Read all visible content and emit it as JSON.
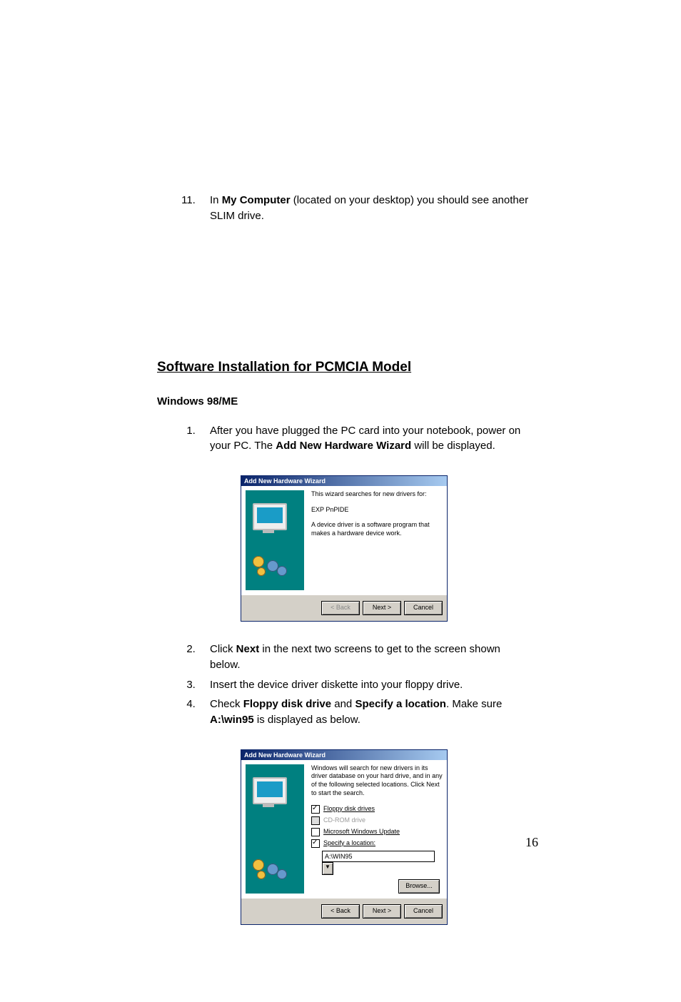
{
  "step11": {
    "num": "11.",
    "pre": "In ",
    "bold": "My Computer",
    "post": " (located on your desktop) you should see another SLIM drive."
  },
  "heading": "Software Installation for PCMCIA Model",
  "subheading": "Windows 98/ME",
  "steps": {
    "s1": {
      "num": "1.",
      "pre": "After you have plugged the PC card into your notebook, power on your PC.  The ",
      "bold": "Add New Hardware Wizard",
      "post": " will be displayed."
    },
    "s2": {
      "num": "2.",
      "pre": "Click ",
      "bold": "Next",
      "post": " in the next two screens to get to the screen shown below."
    },
    "s3": {
      "num": "3.",
      "text": "Insert the device driver diskette into your floppy drive."
    },
    "s4": {
      "num": "4.",
      "pre": "Check ",
      "bold1": "Floppy disk drive",
      "mid": " and ",
      "bold2": "Specify a location",
      "post1": ". Make sure ",
      "bold3": "A:\\win95",
      "post2": " is displayed as below."
    }
  },
  "wizard1": {
    "title": "Add New Hardware Wizard",
    "line1": "This wizard searches for new drivers for:",
    "device": "EXP   PnPIDE",
    "line2": "A device driver is a software program that makes a hardware device work.",
    "back": "< Back",
    "next": "Next >",
    "cancel": "Cancel"
  },
  "wizard2": {
    "title": "Add New Hardware Wizard",
    "intro": "Windows will search for new drivers in its driver database on your hard drive, and in any of the following selected locations. Click Next to start the search.",
    "floppy": "Floppy disk drives",
    "cdrom": "CD-ROM drive",
    "msupdate": "Microsoft Windows Update",
    "specify": "Specify a location:",
    "location": "A:\\WIN95",
    "browse": "Browse...",
    "back": "< Back",
    "next": "Next >",
    "cancel": "Cancel"
  },
  "page_number": "16"
}
